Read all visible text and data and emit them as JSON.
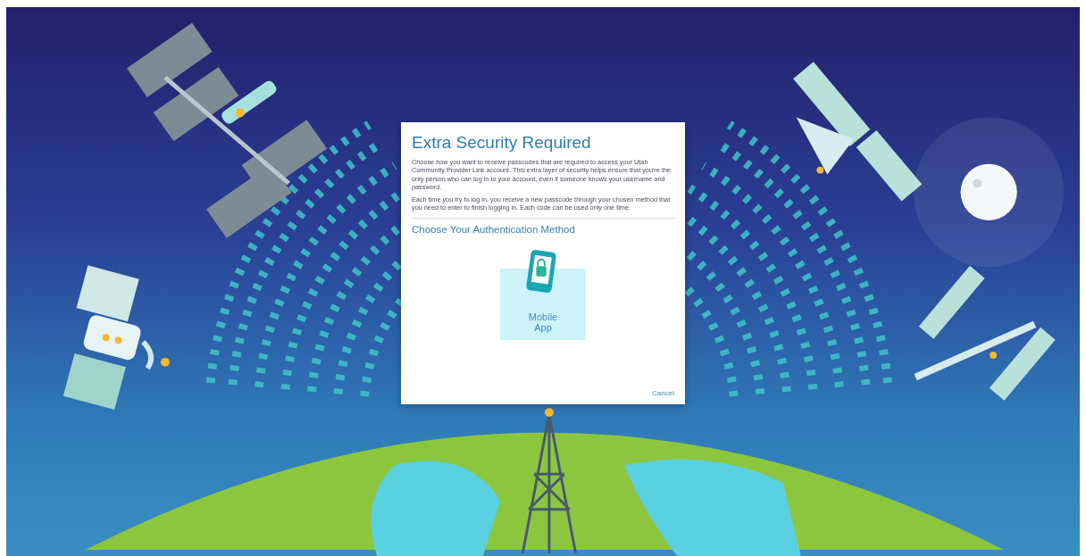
{
  "dialog": {
    "title": "Extra Security Required",
    "paragraphs": [
      "Choose how you want to receive passcodes that are required to access your Utah Community Provider Link account. This extra layer of security helps ensure that you're the only person who can log in to your account, even if someone knows your username and password.",
      "Each time you try to log in, you receive a new passcode through your chosen method that you need to enter to finish logging in. Each code can be used only one time."
    ],
    "section_title": "Choose Your Authentication Method",
    "methods": [
      {
        "label": "Mobile App"
      }
    ],
    "cancel": "Cancel"
  }
}
